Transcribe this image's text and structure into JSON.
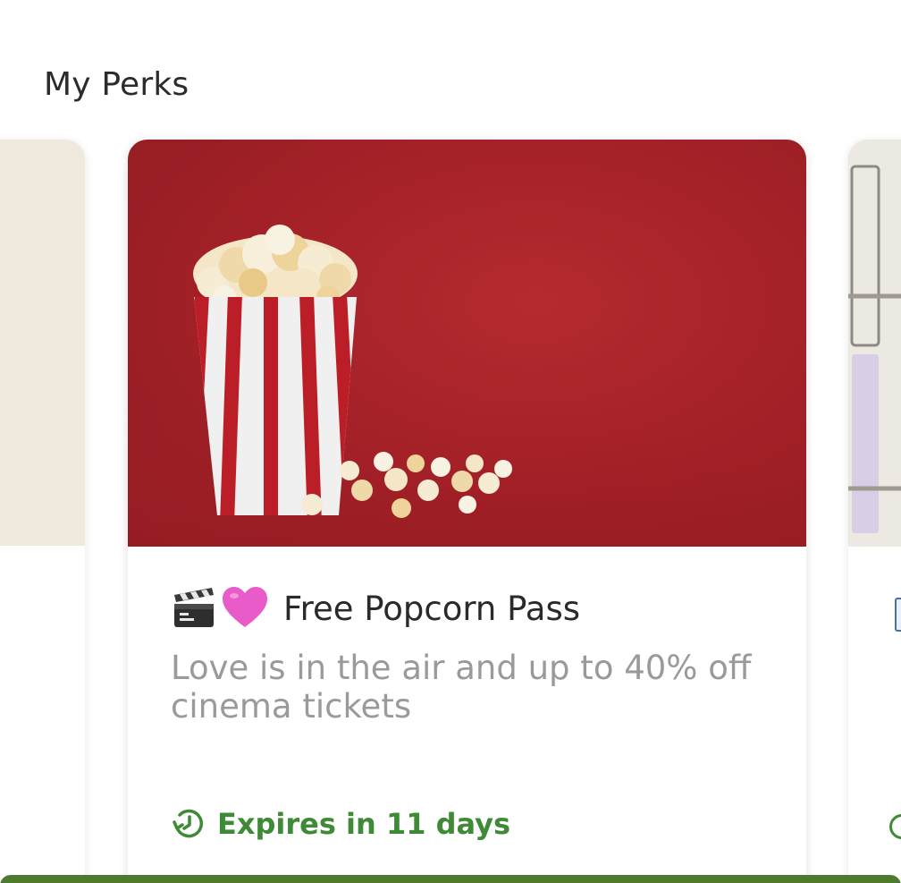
{
  "section": {
    "title": "My Perks"
  },
  "perk": {
    "title": "Free Popcorn Pass",
    "title_icons": [
      "clapper-board-icon",
      "pink-heart-icon"
    ],
    "description": "Love is in the air and up to 40% off cinema tickets",
    "expiry": "Expires in 11 days",
    "expiry_icon": "clock-icon"
  },
  "colors": {
    "accent_green": "#3f8a36",
    "title_text": "#2a2a2a",
    "description_text": "#9a9a9a",
    "hero_red": "#a22027",
    "bottom_bar": "#4e7a2c"
  }
}
